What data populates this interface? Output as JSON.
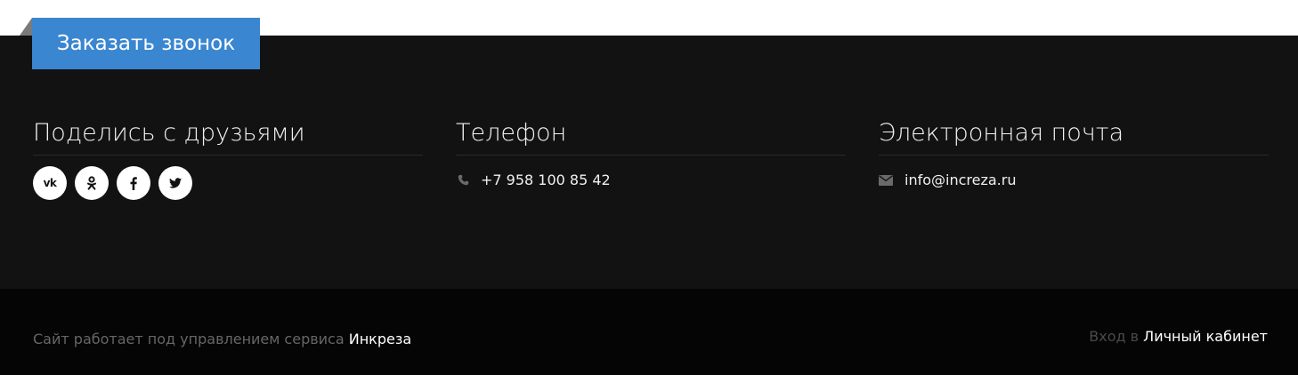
{
  "callback": {
    "label": "Заказать звонок"
  },
  "share": {
    "title": "Поделись с друзьями",
    "networks": [
      {
        "name": "vk",
        "icon": "vk-icon",
        "text": "vk"
      },
      {
        "name": "odnoklassniki",
        "icon": "odnoklassniki-icon"
      },
      {
        "name": "facebook",
        "icon": "facebook-icon"
      },
      {
        "name": "twitter",
        "icon": "twitter-icon"
      }
    ]
  },
  "phone": {
    "title": "Телефон",
    "icon": "phone-icon",
    "value": "+7 958 100 85 42"
  },
  "email": {
    "title": "Электронная почта",
    "icon": "envelope-icon",
    "value": "info@increza.ru"
  },
  "bottom": {
    "powered_text": "Сайт работает под управлением сервиса",
    "powered_link": "Инкреза",
    "login_text": "Вход в",
    "login_link": "Личный кабинет"
  },
  "colors": {
    "accent": "#3a86d1",
    "footer_background": "#121212",
    "bottom_bar_background": "#050505"
  }
}
